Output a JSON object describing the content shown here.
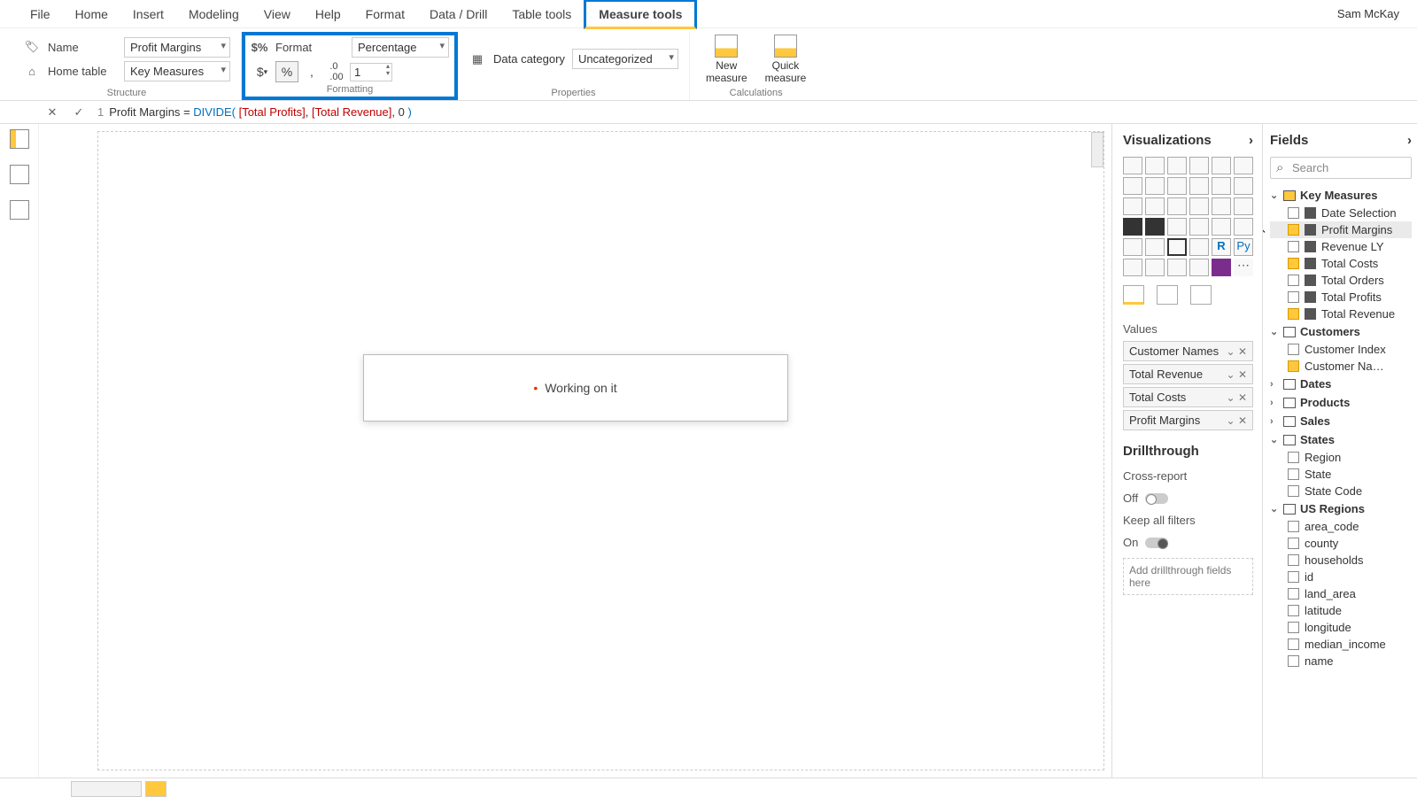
{
  "user": "Sam McKay",
  "menu": [
    "File",
    "Home",
    "Insert",
    "Modeling",
    "View",
    "Help",
    "Format",
    "Data / Drill",
    "Table tools",
    "Measure tools"
  ],
  "active_menu": "Measure tools",
  "ribbon": {
    "structure": {
      "name_label": "Name",
      "name_value": "Profit Margins",
      "home_label": "Home table",
      "home_value": "Key Measures",
      "group_label": "Structure"
    },
    "formatting": {
      "format_label": "Format",
      "format_value": "Percentage",
      "decimals": "1",
      "group_label": "Formatting"
    },
    "properties": {
      "datacat_label": "Data category",
      "datacat_value": "Uncategorized",
      "group_label": "Properties"
    },
    "calculations": {
      "new_measure": "New\nmeasure",
      "quick_measure": "Quick\nmeasure",
      "group_label": "Calculations"
    }
  },
  "formula": {
    "line": "1",
    "name": "Profit Margins",
    "eq": "=",
    "fn": "DIVIDE",
    "open": "(",
    "arg1": "[Total Profits]",
    "comma1": ",",
    "arg2": "[Total Revenue]",
    "comma2": ",",
    "arg3": "0",
    "close": ")"
  },
  "modal": "Working on it",
  "viz_title": "Visualizations",
  "values_label": "Values",
  "values": [
    "Customer Names",
    "Total Revenue",
    "Total Costs",
    "Profit Margins"
  ],
  "drill": {
    "title": "Drillthrough",
    "cross": "Cross-report",
    "off": "Off",
    "keep": "Keep all filters",
    "on": "On",
    "hint": "Add drillthrough fields here"
  },
  "fields_title": "Fields",
  "search_placeholder": "Search",
  "tables": {
    "key_measures": {
      "name": "Key Measures",
      "fields": [
        {
          "name": "Date Selection",
          "checked": false
        },
        {
          "name": "Profit Margins",
          "checked": true,
          "selected": true
        },
        {
          "name": "Revenue LY",
          "checked": false
        },
        {
          "name": "Total Costs",
          "checked": true
        },
        {
          "name": "Total Orders",
          "checked": false
        },
        {
          "name": "Total Profits",
          "checked": false
        },
        {
          "name": "Total Revenue",
          "checked": true
        }
      ]
    },
    "customers": {
      "name": "Customers",
      "fields": [
        {
          "name": "Customer Index",
          "checked": false
        },
        {
          "name": "Customer Na…",
          "checked": true
        }
      ]
    },
    "dates": "Dates",
    "products": "Products",
    "sales": "Sales",
    "states": {
      "name": "States",
      "fields": [
        {
          "name": "Region",
          "checked": false
        },
        {
          "name": "State",
          "checked": false
        },
        {
          "name": "State Code",
          "checked": false
        }
      ]
    },
    "us_regions": {
      "name": "US Regions",
      "fields": [
        {
          "name": "area_code",
          "checked": false
        },
        {
          "name": "county",
          "checked": false
        },
        {
          "name": "households",
          "checked": false
        },
        {
          "name": "id",
          "checked": false
        },
        {
          "name": "land_area",
          "checked": false
        },
        {
          "name": "latitude",
          "checked": false
        },
        {
          "name": "longitude",
          "checked": false
        },
        {
          "name": "median_income",
          "checked": false
        },
        {
          "name": "name",
          "checked": false
        }
      ]
    }
  }
}
